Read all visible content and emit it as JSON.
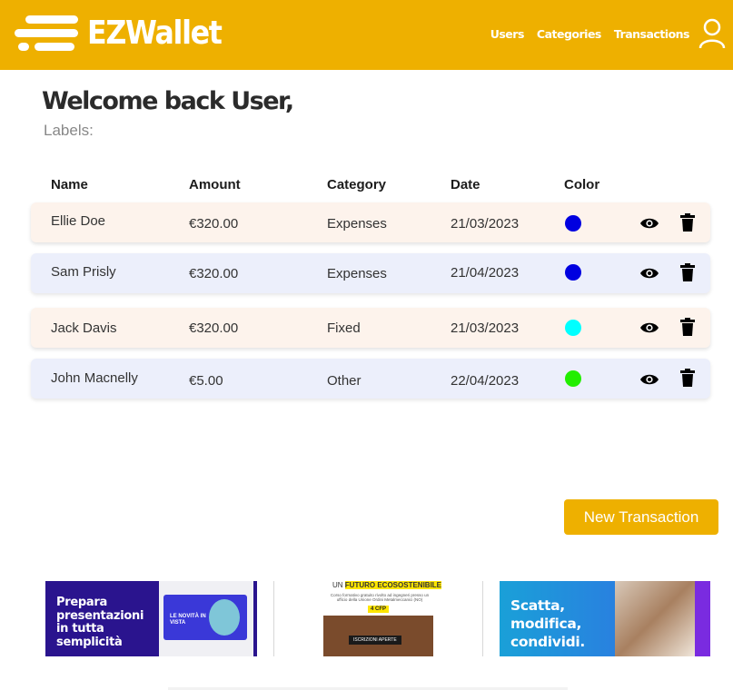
{
  "header": {
    "logo_text": "EZWallet",
    "nav": [
      "Users",
      "Categories",
      "Transactions"
    ],
    "brand_color": "#eeb000"
  },
  "welcome": {
    "title": "Welcome back User,",
    "labels": "Labels:"
  },
  "table": {
    "columns": [
      "Name",
      "Amount",
      "Category",
      "Date",
      "Color"
    ],
    "rows": [
      {
        "name": "Ellie Doe",
        "amount": "€320.00",
        "category": "Expenses",
        "date": "21/03/2023",
        "color": "#0000e0"
      },
      {
        "name": "Sam Prisly",
        "amount": "€320.00",
        "category": "Expenses",
        "date": "21/04/2023",
        "color": "#0000e0"
      },
      {
        "name": "Jack Davis",
        "amount": "€320.00",
        "category": "Fixed",
        "date": "21/03/2023",
        "color": "#00ffff"
      },
      {
        "name": "John Macnelly",
        "amount": "€5.00",
        "category": "Other",
        "date": "22/04/2023",
        "color": "#22ee00"
      }
    ]
  },
  "actions": {
    "new_transaction": "New Transaction"
  },
  "ads": {
    "ad1_text": "Prepara presentazioni in tutta semplicità",
    "ad1_card": "LE NOVITÀ IN VISTA",
    "ad2_head_plain": "UN ",
    "ad2_head_highlight": "FUTURO ECOSOSTENIBILE",
    "ad2_sub": "Corso formativo gratuito rivolto ad ingegneri presso un ufficio della Unione Ordini Metalmeccanici (NO)",
    "ad2_cfp": "4 CFP",
    "ad2_btn": "ISCRIZIONI APERTE",
    "ad3_text": "Scatta, modifica, condividi."
  }
}
